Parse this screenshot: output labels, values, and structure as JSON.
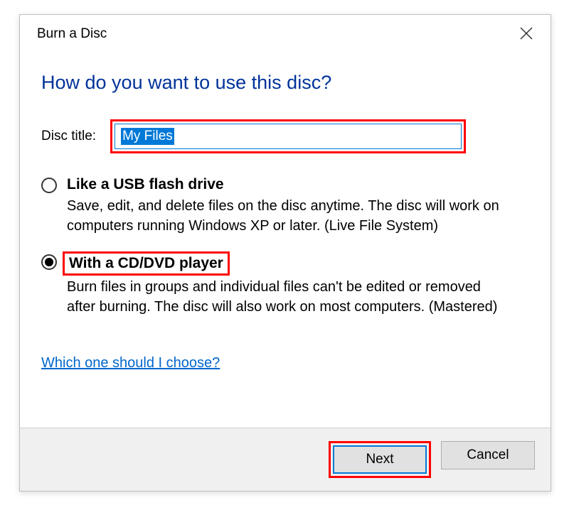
{
  "titlebar": {
    "title": "Burn a Disc"
  },
  "heading": "How do you want to use this disc?",
  "disc_title": {
    "label": "Disc title:",
    "value": "My Files"
  },
  "options": [
    {
      "label": "Like a USB flash drive",
      "description": "Save, edit, and delete files on the disc anytime. The disc will work on computers running Windows XP or later. (Live File System)",
      "selected": false
    },
    {
      "label": "With a CD/DVD player",
      "description": "Burn files in groups and individual files can't be edited or removed after burning. The disc will also work on most computers. (Mastered)",
      "selected": true
    }
  ],
  "help_link": "Which one should I choose?",
  "buttons": {
    "next": "Next",
    "cancel": "Cancel"
  }
}
